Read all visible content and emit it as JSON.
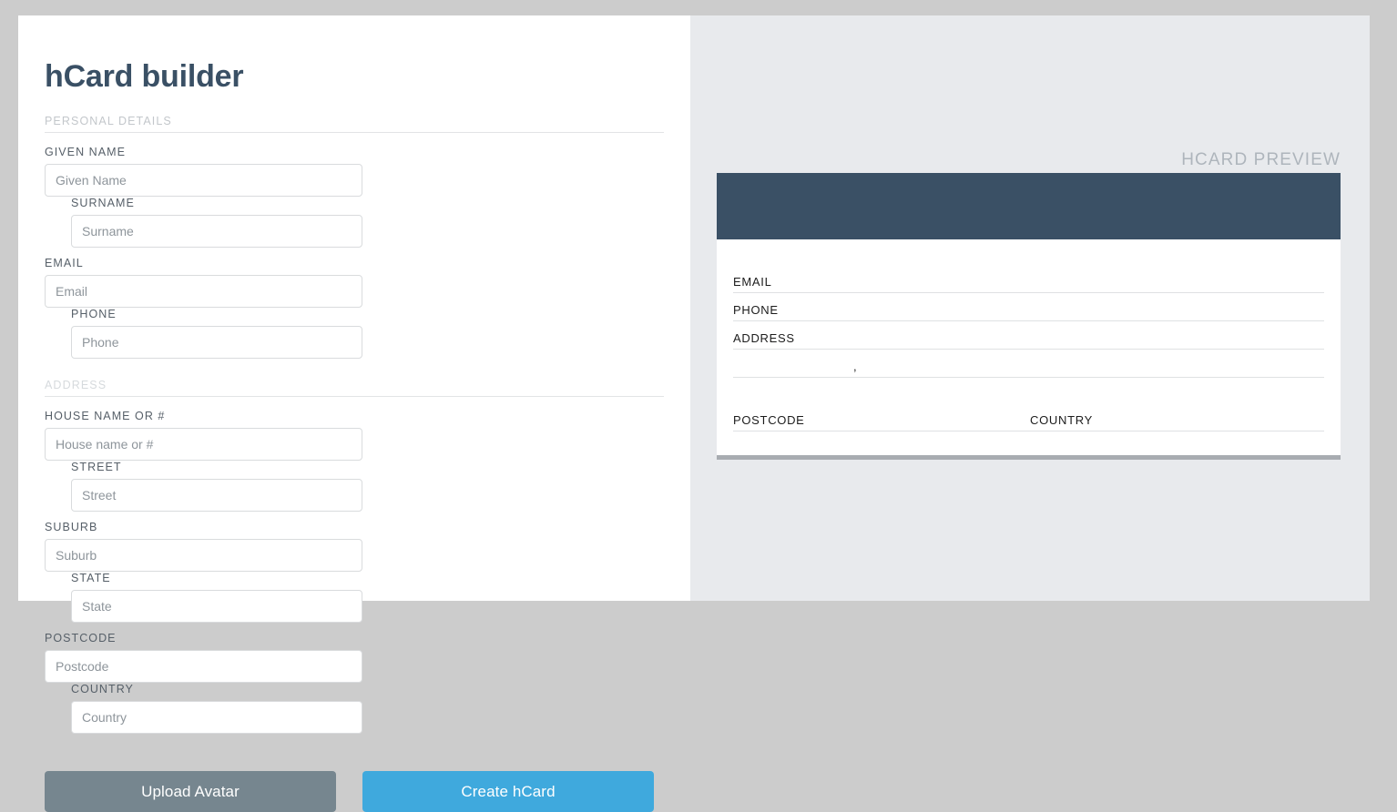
{
  "app": {
    "title": "hCard builder"
  },
  "sections": {
    "personal": {
      "heading": "PERSONAL DETAILS",
      "fields": [
        {
          "label": "GIVEN NAME",
          "placeholder": "Given Name",
          "value": ""
        },
        {
          "label": "SURNAME",
          "placeholder": "Surname",
          "value": ""
        },
        {
          "label": "EMAIL",
          "placeholder": "Email",
          "value": ""
        },
        {
          "label": "PHONE",
          "placeholder": "Phone",
          "value": ""
        }
      ]
    },
    "address": {
      "heading": "ADDRESS",
      "fields": [
        {
          "label": "HOUSE NAME OR #",
          "placeholder": "House name or #",
          "value": ""
        },
        {
          "label": "STREET",
          "placeholder": "Street",
          "value": ""
        },
        {
          "label": "SUBURB",
          "placeholder": "Suburb",
          "value": ""
        },
        {
          "label": "STATE",
          "placeholder": "State",
          "value": ""
        },
        {
          "label": "POSTCODE",
          "placeholder": "Postcode",
          "value": ""
        },
        {
          "label": "COUNTRY",
          "placeholder": "Country",
          "value": ""
        }
      ]
    }
  },
  "actions": {
    "upload_avatar_label": "Upload Avatar",
    "create_hcard_label": "Create hCard"
  },
  "preview": {
    "caption": "HCARD PREVIEW",
    "name": "",
    "rows": [
      {
        "left": "EMAIL",
        "mid": "",
        "half": ""
      },
      {
        "left": "PHONE",
        "mid": "",
        "half": ""
      },
      {
        "left": "ADDRESS",
        "mid": "",
        "half": ""
      },
      {
        "left": "",
        "mid": ",",
        "half": ""
      },
      {
        "left": "POSTCODE",
        "mid": "",
        "half": "COUNTRY"
      }
    ]
  },
  "colors": {
    "page_background": "#cccccc",
    "panel_background": "#ffffff",
    "preview_background": "#e8eaed",
    "brand_dark": "#3a5065",
    "accent_blue": "#3fa9dd",
    "secondary_gray": "#76868f",
    "muted_text": "#c3c7cb"
  }
}
